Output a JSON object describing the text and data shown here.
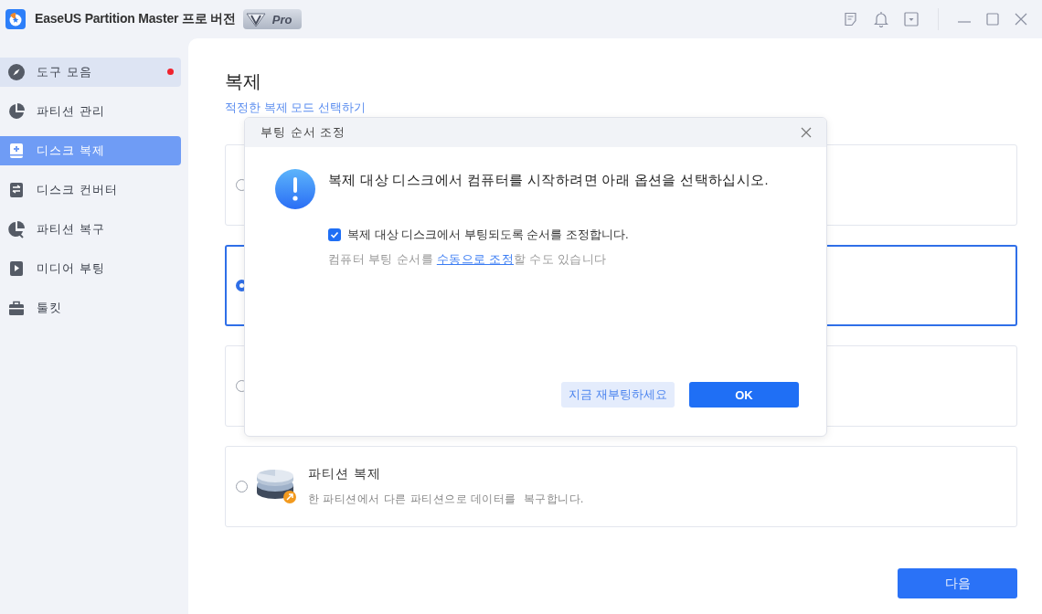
{
  "window": {
    "title": "EaseUS Partition Master 프로 버전",
    "edition_badge": "Pro"
  },
  "sidebar": {
    "items": [
      {
        "label": "도구 모음",
        "selected": false,
        "highlighted": true,
        "badge": true
      },
      {
        "label": "파티션 관리",
        "selected": false,
        "highlighted": false,
        "badge": false
      },
      {
        "label": "디스크 복제",
        "selected": true,
        "highlighted": false,
        "badge": false
      },
      {
        "label": "디스크 컨버터",
        "selected": false,
        "highlighted": false,
        "badge": false
      },
      {
        "label": "파티션 복구",
        "selected": false,
        "highlighted": false,
        "badge": false
      },
      {
        "label": "미디어 부팅",
        "selected": false,
        "highlighted": false,
        "badge": false
      },
      {
        "label": "툴킷",
        "selected": false,
        "highlighted": false,
        "badge": false
      }
    ]
  },
  "page": {
    "title": "복제",
    "subtitle": "적정한 복제 모드 선택하기",
    "options": [
      {
        "selected": false
      },
      {
        "selected": true
      },
      {
        "selected": false
      },
      {
        "selected": false,
        "title": "파티션 복제",
        "description": "한 파티션에서 다른 파티션으로 데이터를  복구합니다."
      }
    ],
    "next_button": "다음"
  },
  "dialog": {
    "title": "부팅 순서 조정",
    "message": "복제 대상 디스크에서 컴퓨터를 시작하려면 아래 옵션을 선택하십시오.",
    "checkbox": {
      "label": "복제 대상 디스크에서 부팅되도록 순서를 조정합니다.",
      "checked": true
    },
    "hint_before": "컴퓨터 부팅 순서를 ",
    "hint_link": "수동으로 조정",
    "hint_after": "할 수도 있습니다",
    "buttons": [
      {
        "label": "지금 재부팅하세요",
        "kind": "secondary"
      },
      {
        "label": "OK",
        "kind": "primary"
      }
    ]
  }
}
